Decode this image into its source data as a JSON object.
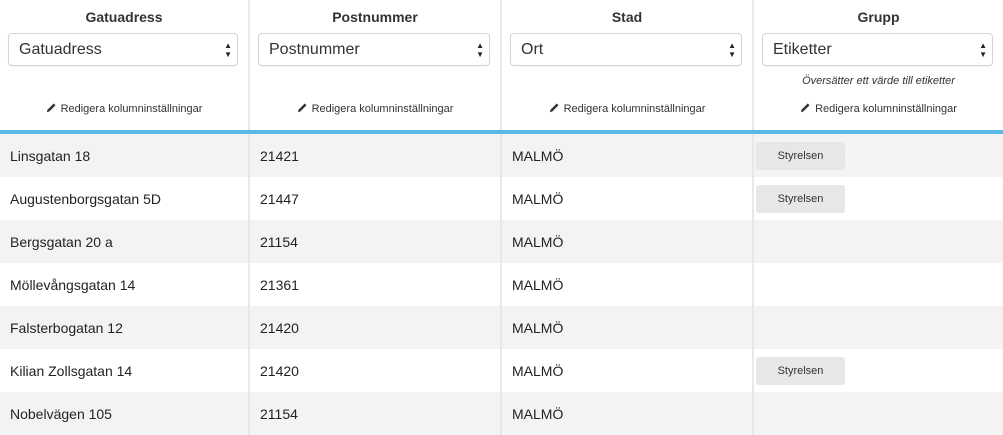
{
  "columns": [
    {
      "title": "Gatuadress",
      "select_value": "Gatuadress",
      "hint": "",
      "edit_label": "Redigera kolumninställningar"
    },
    {
      "title": "Postnummer",
      "select_value": "Postnummer",
      "hint": "",
      "edit_label": "Redigera kolumninställningar"
    },
    {
      "title": "Stad",
      "select_value": "Ort",
      "hint": "",
      "edit_label": "Redigera kolumninställningar"
    },
    {
      "title": "Grupp",
      "select_value": "Etiketter",
      "hint": "Översätter ett värde till etiketter",
      "edit_label": "Redigera kolumninställningar"
    }
  ],
  "rows": [
    {
      "street": "Linsgatan 18",
      "postcode": "21421",
      "city": "MALMÖ",
      "tag": "Styrelsen"
    },
    {
      "street": "Augustenborgsgatan 5D",
      "postcode": "21447",
      "city": "MALMÖ",
      "tag": "Styrelsen"
    },
    {
      "street": "Bergsgatan 20 a",
      "postcode": "21154",
      "city": "MALMÖ",
      "tag": ""
    },
    {
      "street": "Möllevångsgatan 14",
      "postcode": "21361",
      "city": "MALMÖ",
      "tag": ""
    },
    {
      "street": "Falsterbogatan 12",
      "postcode": "21420",
      "city": "MALMÖ",
      "tag": ""
    },
    {
      "street": "Kilian Zollsgatan 14",
      "postcode": "21420",
      "city": "MALMÖ",
      "tag": "Styrelsen"
    },
    {
      "street": "Nobelvägen 105",
      "postcode": "21154",
      "city": "MALMÖ",
      "tag": ""
    }
  ],
  "colors": {
    "accent": "#5bb7e5",
    "row_alt": "#f3f3f3",
    "tag_bg": "#e7e7e7"
  },
  "icons": {
    "edit": "pencil-icon",
    "select": "select-arrows-icon"
  }
}
